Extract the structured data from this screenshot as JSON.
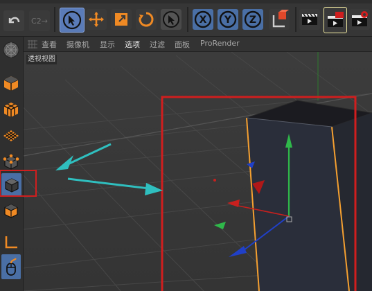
{
  "viewport": {
    "label": "透视视图",
    "menu": [
      "查看",
      "摄像机",
      "显示",
      "选项",
      "过滤",
      "面板",
      "ProRender"
    ],
    "active_menu_index": 3
  },
  "colors": {
    "toolbar_bg": "#363636",
    "button_blue": "#4a6fa5",
    "icon_orange": "#f08a24",
    "annotation_red": "#d01e1e",
    "annotation_arrow": "#2fbfbf",
    "axis_green": "#2fb84a",
    "axis_red": "#c8201e",
    "axis_blue": "#2040c8",
    "cube_edge_orange": "#f5a030"
  },
  "icons": {
    "toolbar": [
      "undo-icon",
      "redo-icon",
      "select-arrow-icon",
      "move-icon",
      "scale-icon",
      "rotate-icon",
      "live-select-icon",
      "x-axis-lock-icon",
      "y-axis-lock-icon",
      "z-axis-lock-icon",
      "coordinate-system-icon",
      "render-view-icon",
      "render-picture-viewer-icon",
      "render-settings-icon"
    ],
    "sidebar": [
      "model-mode-icon",
      "make-editable-icon",
      "texture-mode-icon",
      "workplane-icon",
      "points-mode-icon",
      "polygons-mode-icon",
      "edges-mode-icon",
      "axis-mode-icon",
      "tweak-mode-icon"
    ]
  },
  "toolbar": {
    "redo_label": "C2→"
  }
}
